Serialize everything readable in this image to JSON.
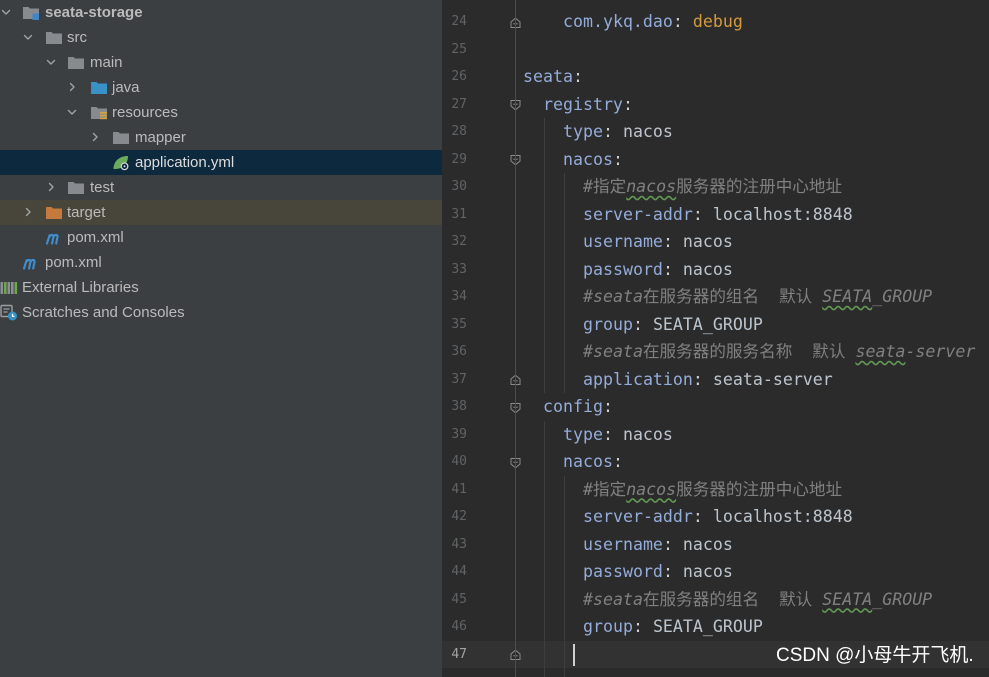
{
  "project_tree": {
    "items": [
      {
        "label": "seata-storage",
        "icon": "module-folder-icon",
        "expanded": true
      },
      {
        "label": "src",
        "icon": "folder-icon",
        "expanded": true
      },
      {
        "label": "main",
        "icon": "folder-icon",
        "expanded": true
      },
      {
        "label": "java",
        "icon": "source-folder-icon",
        "expanded": false
      },
      {
        "label": "resources",
        "icon": "resources-folder-icon",
        "expanded": true
      },
      {
        "label": "mapper",
        "icon": "folder-icon",
        "expanded": false
      },
      {
        "label": "application.yml",
        "icon": "spring-config-icon",
        "selected": true
      },
      {
        "label": "test",
        "icon": "folder-icon",
        "expanded": false
      },
      {
        "label": "target",
        "icon": "excluded-folder-icon",
        "expanded": false
      },
      {
        "label": "pom.xml",
        "icon": "maven-icon"
      },
      {
        "label": "pom.xml",
        "icon": "maven-icon"
      },
      {
        "label": "External Libraries",
        "icon": "libraries-icon"
      },
      {
        "label": "Scratches and Consoles",
        "icon": "scratches-icon"
      }
    ]
  },
  "editor": {
    "current_line": 47,
    "fold_start_lines": [
      27,
      29,
      38,
      40
    ],
    "fold_end_lines": [
      24,
      37,
      47
    ],
    "lines": [
      {
        "n": "24",
        "key": "com.ykq.dao",
        "sep": ": ",
        "value": "debug"
      },
      {
        "n": "25"
      },
      {
        "n": "26",
        "key": "seata",
        "sep": ":"
      },
      {
        "n": "27",
        "key": "registry",
        "sep": ":"
      },
      {
        "n": "28",
        "key": "type",
        "sep": ": ",
        "value": "nacos"
      },
      {
        "n": "29",
        "key": "nacos",
        "sep": ":"
      },
      {
        "n": "30",
        "comment": [
          "#指定",
          "nacos",
          "服务器的注册中心地址"
        ]
      },
      {
        "n": "31",
        "key": "server-addr",
        "sep": ": ",
        "value": "localhost:8848"
      },
      {
        "n": "32",
        "key": "username",
        "sep": ": ",
        "value": "nacos"
      },
      {
        "n": "33",
        "key": "password",
        "sep": ": ",
        "value": "nacos"
      },
      {
        "n": "34",
        "comment": [
          "#seata",
          "在服务器的组名  默认 ",
          "SEATA",
          "_GROUP"
        ]
      },
      {
        "n": "35",
        "key": "group",
        "sep": ": ",
        "value": "SEATA_GROUP"
      },
      {
        "n": "36",
        "comment": [
          "#seata",
          "在服务器的服务名称  默认 ",
          "seata",
          "-server"
        ]
      },
      {
        "n": "37",
        "key": "application",
        "sep": ": ",
        "value": "seata-server"
      },
      {
        "n": "38",
        "key": "config",
        "sep": ":"
      },
      {
        "n": "39",
        "key": "type",
        "sep": ": ",
        "value": "nacos"
      },
      {
        "n": "40",
        "key": "nacos",
        "sep": ":"
      },
      {
        "n": "41",
        "comment": [
          "#指定",
          "nacos",
          "服务器的注册中心地址"
        ]
      },
      {
        "n": "42",
        "key": "server-addr",
        "sep": ": ",
        "value": "localhost:8848"
      },
      {
        "n": "43",
        "key": "username",
        "sep": ": ",
        "value": "nacos"
      },
      {
        "n": "44",
        "key": "password",
        "sep": ": ",
        "value": "nacos"
      },
      {
        "n": "45",
        "comment": [
          "#seata",
          "在服务器的组名  默认 ",
          "SEATA",
          "_GROUP"
        ]
      },
      {
        "n": "46",
        "key": "group",
        "sep": ": ",
        "value": "SEATA_GROUP"
      },
      {
        "n": "47"
      }
    ]
  },
  "watermark": "CSDN @小母牛开飞机.",
  "colors": {
    "tree_background": "#3c3f41",
    "tree_selection": "#0d293e",
    "editor_background": "#2b2b2b",
    "current_line": "#323232",
    "yaml_key": "#94acd9",
    "yaml_value": "#bcc5ce",
    "comment": "#808080",
    "special_value": "#d49a3e"
  }
}
